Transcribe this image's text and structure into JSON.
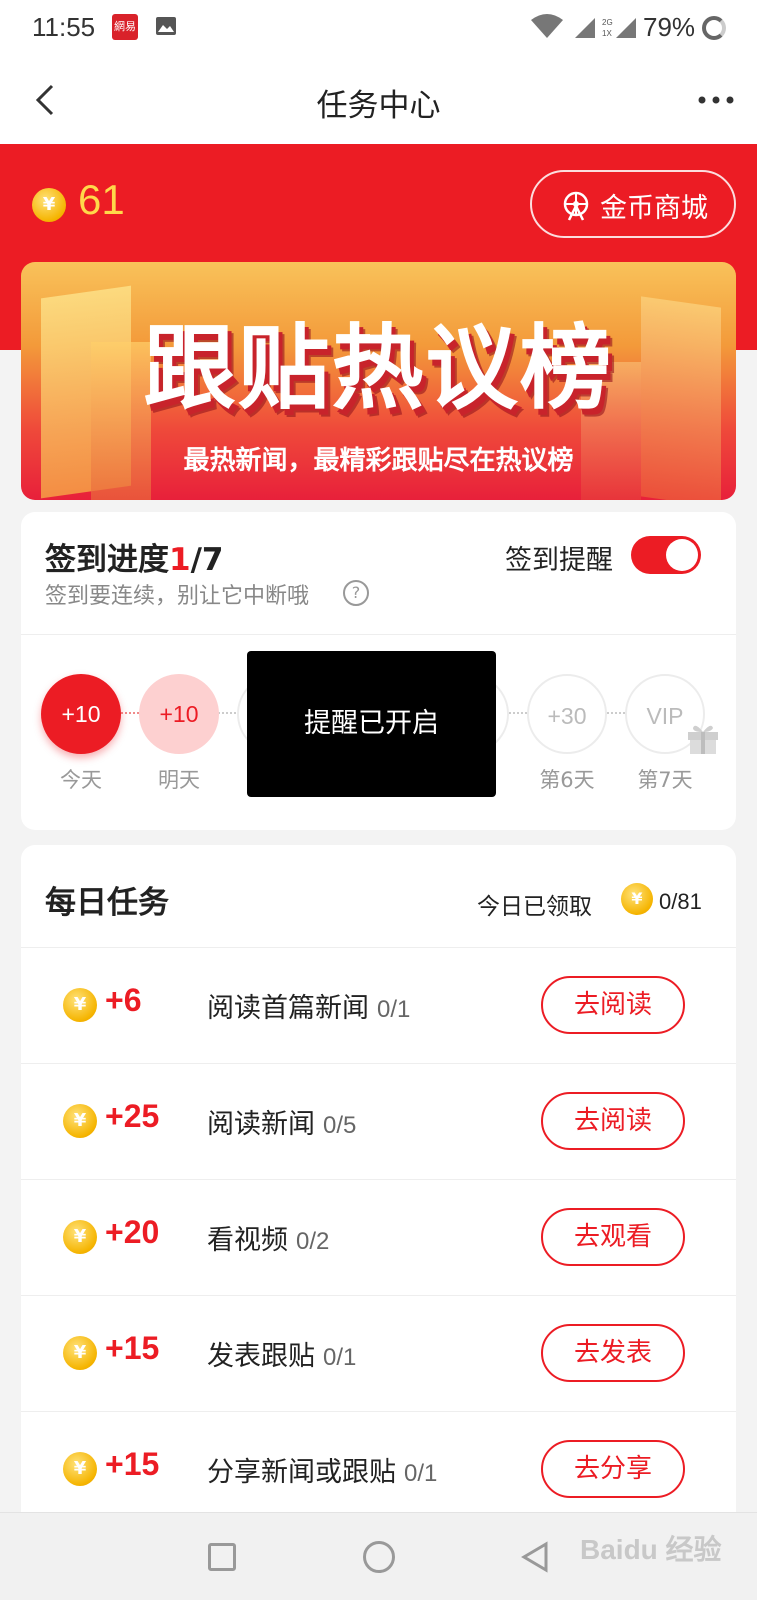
{
  "status_bar": {
    "time": "11:55",
    "app_badge": "網易",
    "battery": "79%",
    "network": "2G 1X"
  },
  "nav": {
    "title": "任务中心"
  },
  "header": {
    "balance": "61",
    "coin_symbol": "¥",
    "mall_label": "金币商城"
  },
  "banner": {
    "title": "跟贴热议榜",
    "subtitle": "最热新闻，最精彩跟贴尽在热议榜"
  },
  "signin": {
    "title_prefix": "签到进度",
    "current": "1",
    "total_suffix": "/7",
    "subtitle": "签到要连续，别让它中断哦",
    "help": "?",
    "remind_label": "签到提醒",
    "remind_on": true,
    "days": [
      {
        "value": "+10",
        "label": "今天",
        "state": "today"
      },
      {
        "value": "+10",
        "label": "明天",
        "state": "tomorrow"
      },
      {
        "value": "+30",
        "label": "第6天",
        "state": "future"
      },
      {
        "value": "VIP",
        "label": "第7天",
        "state": "future"
      }
    ]
  },
  "toast": {
    "text": "提醒已开启"
  },
  "daily_tasks": {
    "title": "每日任务",
    "received_label": "今日已领取",
    "received_count": "0/81",
    "tasks": [
      {
        "reward": "+6",
        "name": "阅读首篇新闻",
        "progress": "0/1",
        "button": "去阅读"
      },
      {
        "reward": "+25",
        "name": "阅读新闻",
        "progress": "0/5",
        "button": "去阅读"
      },
      {
        "reward": "+20",
        "name": "看视频",
        "progress": "0/2",
        "button": "去观看"
      },
      {
        "reward": "+15",
        "name": "发表跟贴",
        "progress": "0/1",
        "button": "去发表"
      },
      {
        "reward": "+15",
        "name": "分享新闻或跟贴",
        "progress": "0/1",
        "button": "去分享"
      }
    ]
  },
  "watermark": "Baidu 经验",
  "colors": {
    "brand_red": "#ec1c24",
    "coin_gold": "#f5b400",
    "balance_yellow": "#ffd84a"
  }
}
